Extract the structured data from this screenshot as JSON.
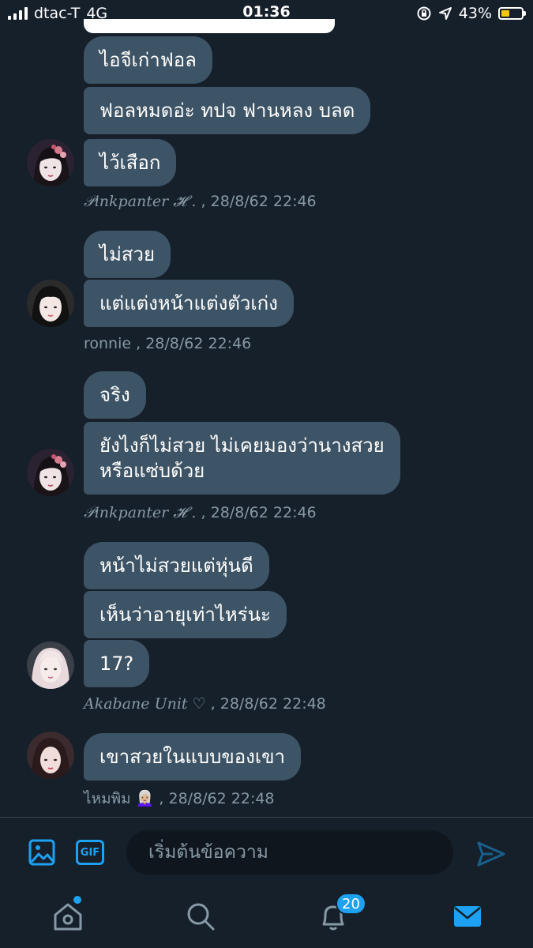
{
  "status_bar": {
    "carrier": "dtac-T",
    "network": "4G",
    "time": "01:36",
    "battery": "43%",
    "battery_level": 0.43,
    "icons": [
      "signal-icon",
      "lock-rotation-icon",
      "location-icon",
      "battery-icon"
    ]
  },
  "messages": [
    {
      "bubbles": [
        "ไอจีเก่าฟอล",
        "ฟอลหมดอ่ะ ทปจ ฟานหลง บลด",
        "ไว้เสือก"
      ],
      "sender": "𝒫inkpanter 𝓗 .",
      "timestamp": ", 28/8/62 22:46"
    },
    {
      "bubbles": [
        "ไม่สวย",
        "แต่แต่งหน้าแต่งตัวเก่ง"
      ],
      "sender": "ronnie",
      "timestamp": ", 28/8/62 22:46"
    },
    {
      "bubbles": [
        "จริง",
        "ยังไงก็ไม่สวย ไม่เคยมองว่านางสวย\nหรือแซ่บด้วย"
      ],
      "sender": "𝒫inkpanter 𝓗 .",
      "timestamp": ", 28/8/62 22:46"
    },
    {
      "bubbles": [
        "หน้าไม่สวยแต่หุ่นดี",
        "เห็นว่าอายุเท่าไหร่นะ",
        "17?"
      ],
      "sender": "Akabane Unit ♡",
      "timestamp": ", 28/8/62 22:48"
    },
    {
      "bubbles": [
        "เขาสวยในแบบของเขา"
      ],
      "sender": "ไหมพิม 👩🏼‍🦳",
      "timestamp": ", 28/8/62 22:48"
    }
  ],
  "composer": {
    "placeholder": "เริ่มต้นข้อความ",
    "gif_label": "GIF"
  },
  "tab_bar": {
    "notification_count": "20",
    "active_tab": "messages"
  },
  "colors": {
    "background": "#15202b",
    "bubble": "#3d5466",
    "accent": "#1da1f2",
    "meta_text": "#8899a6"
  }
}
